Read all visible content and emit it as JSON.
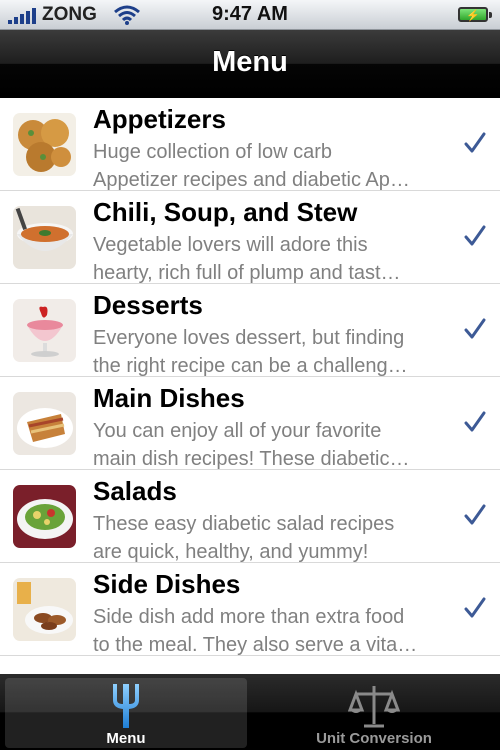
{
  "status_bar": {
    "carrier": "ZONG",
    "time": "9:47 AM"
  },
  "nav": {
    "title": "Menu"
  },
  "colors": {
    "checkmark": "#3d5a96",
    "title_text": "#000000",
    "description_text": "#808080",
    "tab_active": "#3aa0e8"
  },
  "items": [
    {
      "title": "Appetizers",
      "desc_line1": "Huge collection of low carb",
      "desc_line2": "Appetizer recipes and diabetic Ap…",
      "icon": "appetizers-photo"
    },
    {
      "title": "Chili, Soup, and Stew",
      "desc_line1": "Vegetable lovers will adore this",
      "desc_line2": "hearty, rich full of plump and tast…",
      "icon": "soup-photo"
    },
    {
      "title": "Desserts",
      "desc_line1": "Everyone loves dessert, but finding",
      "desc_line2": "the right recipe can be a challeng…",
      "icon": "dessert-photo"
    },
    {
      "title": "Main Dishes",
      "desc_line1": "You can enjoy all of your favorite",
      "desc_line2": "main dish recipes! These diabetic…",
      "icon": "main-dish-photo"
    },
    {
      "title": "Salads",
      "desc_line1": "These easy diabetic salad recipes",
      "desc_line2": "are quick, healthy, and yummy!",
      "icon": "salad-photo"
    },
    {
      "title": "Side Dishes",
      "desc_line1": "Side dish add more than extra food",
      "desc_line2": "to the meal. They also serve a vita…",
      "icon": "side-dish-photo"
    }
  ],
  "tabs": [
    {
      "label": "Menu",
      "icon": "fork-icon",
      "active": true
    },
    {
      "label": "Unit Conversion",
      "icon": "scale-icon",
      "active": false
    }
  ]
}
